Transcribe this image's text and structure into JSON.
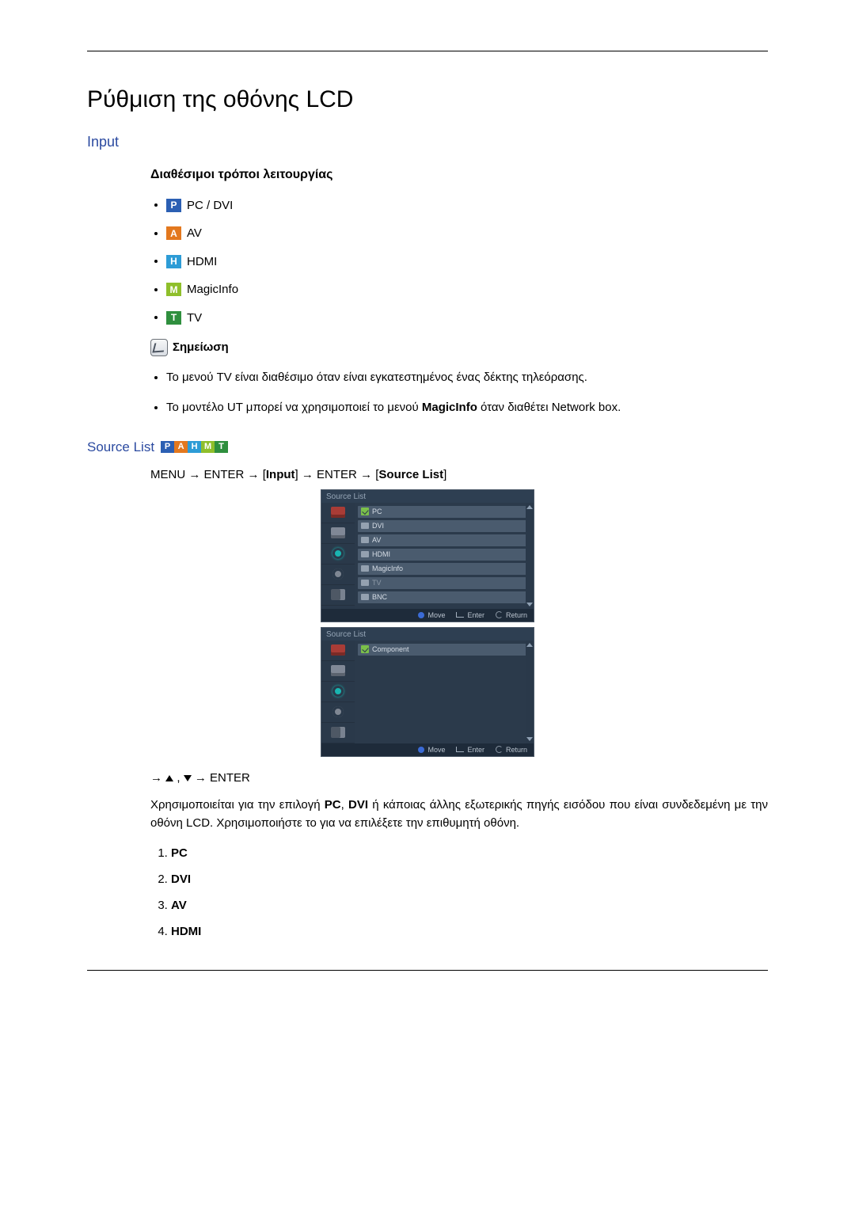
{
  "title": "Ρύθμιση της οθόνης LCD",
  "input_label": "Input",
  "modes_heading": "Διαθέσιμοι τρόποι λειτουργίας",
  "modes": [
    {
      "badge": "P",
      "label": "PC / DVI"
    },
    {
      "badge": "A",
      "label": "AV"
    },
    {
      "badge": "H",
      "label": "HDMI"
    },
    {
      "badge": "M",
      "label": "MagicInfo"
    },
    {
      "badge": "T",
      "label": "TV"
    }
  ],
  "note_label": "Σημείωση",
  "notes": {
    "0": "Το μενού TV είναι διαθέσιμο όταν είναι εγκατεστημένος ένας δέκτης τηλεόρασης.",
    "1_a": "Το μοντέλο UT μπορεί να χρησιμοποιεί το μενού ",
    "1_b": "MagicInfo",
    "1_c": " όταν διαθέτει Network box."
  },
  "source_list_label": "Source List",
  "badges_strip": [
    "P",
    "A",
    "H",
    "M",
    "T"
  ],
  "nav": {
    "menu": "MENU",
    "enter": "ENTER",
    "input": "Input",
    "source_list": "Source List",
    "arrow": "→"
  },
  "osd": {
    "header": "Source List",
    "items1": [
      {
        "label": "PC",
        "chk": true
      },
      {
        "label": "DVI",
        "ico": true
      },
      {
        "label": "AV",
        "ico": true
      },
      {
        "label": "HDMI",
        "ico": true
      },
      {
        "label": "MagicInfo",
        "ico": true
      },
      {
        "label": "TV",
        "gray": true,
        "ico": true
      },
      {
        "label": "BNC",
        "ico": true
      }
    ],
    "items2": [
      {
        "label": "Component",
        "chk": true
      }
    ],
    "footer": {
      "move": "Move",
      "enter": "Enter",
      "ret": "Return"
    }
  },
  "nav2": {
    "prefix": "→",
    "comma": ",",
    "arrow2": "→",
    "enter": "ENTER"
  },
  "para": {
    "a": "Χρησιμοποιείται για την επιλογή ",
    "pc": "PC",
    "c1": ", ",
    "dvi": "DVI",
    "b": " ή κάποιας άλλης εξωτερικής πηγής εισόδου που είναι συνδεδεμένη με την οθόνη LCD. Χρησιμοποιήστε το για να επιλέξετε την επιθυμητή οθόνη."
  },
  "numlist": [
    "PC",
    "DVI",
    "AV",
    "HDMI"
  ]
}
